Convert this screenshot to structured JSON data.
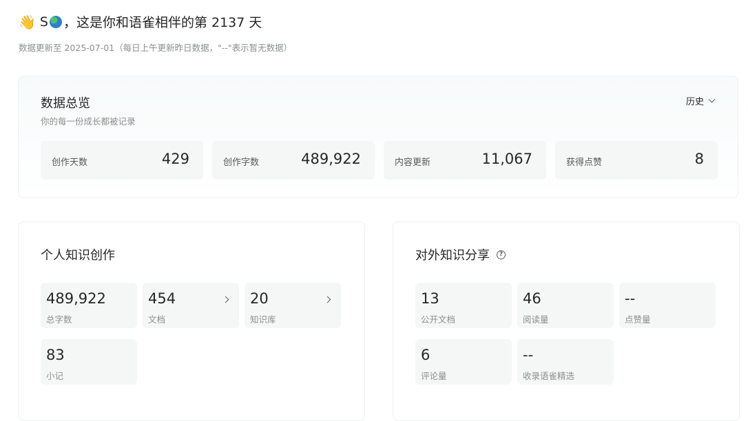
{
  "greeting": {
    "wave_icon": "👋",
    "name_initial": "S",
    "globe_icon": "globe-icon",
    "text": "，这是你和语雀相伴的第 2137 天"
  },
  "update_note": "数据更新至 2025-07-01（每日上午更新昨日数据，\"--\"表示暂无数据）",
  "overview": {
    "title": "数据总览",
    "subtitle": "你的每一份成长都被记录",
    "history_label": "历史",
    "stats": [
      {
        "label": "创作天数",
        "value": "429"
      },
      {
        "label": "创作字数",
        "value": "489,922"
      },
      {
        "label": "内容更新",
        "value": "11,067"
      },
      {
        "label": "获得点赞",
        "value": "8"
      }
    ]
  },
  "personal": {
    "title": "个人知识创作",
    "tiles": [
      {
        "value": "489,922",
        "label": "总字数"
      },
      {
        "value": "454",
        "label": "文档"
      },
      {
        "value": "20",
        "label": "知识库"
      },
      {
        "value": "83",
        "label": "小记"
      }
    ]
  },
  "sharing": {
    "title": "对外知识分享",
    "tiles": [
      {
        "value": "13",
        "label": "公开文档"
      },
      {
        "value": "46",
        "label": "阅读量"
      },
      {
        "value": "--",
        "label": "点赞量"
      },
      {
        "value": "6",
        "label": "评论量"
      },
      {
        "value": "--",
        "label": "收录语雀精选"
      }
    ]
  }
}
